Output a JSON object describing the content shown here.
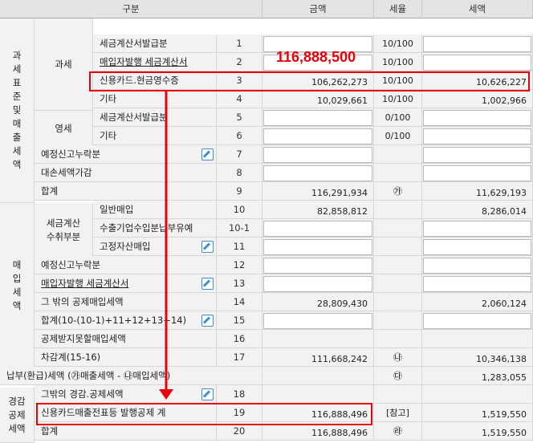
{
  "header": {
    "col_gubun": "구분",
    "col_amount": "금액",
    "col_rate": "세율",
    "col_tax": "세액"
  },
  "sections": {
    "sales": "과\n세\n표\n준\n및\n매\n출\n세\n액",
    "taxable": "과세",
    "zero_rate": "영세",
    "purchase": "매\n입\n세\n액",
    "invoice_received": "세금계산\n수취부분",
    "deduction": "경감\n공제\n세액"
  },
  "rows": [
    {
      "no": "1",
      "label": "세금계산서발급분",
      "amount": "",
      "rate": "10/100",
      "tax": ""
    },
    {
      "no": "2",
      "label": "매입자발행 세금계산서",
      "amount": "",
      "rate": "10/100",
      "tax": ""
    },
    {
      "no": "3",
      "label": "신용카드.현금영수증",
      "amount": "106,262,273",
      "rate": "10/100",
      "tax": "10,626,227"
    },
    {
      "no": "4",
      "label": "기타",
      "amount": "10,029,661",
      "rate": "10/100",
      "tax": "1,002,966"
    },
    {
      "no": "5",
      "label": "세금계산서발급분",
      "amount": "",
      "rate": "0/100",
      "tax": ""
    },
    {
      "no": "6",
      "label": "기타",
      "amount": "",
      "rate": "0/100",
      "tax": ""
    },
    {
      "no": "7",
      "label": "예정신고누락분",
      "amount": "",
      "rate": "",
      "tax": ""
    },
    {
      "no": "8",
      "label": "대손세액가감",
      "amount": "",
      "rate": "",
      "tax": ""
    },
    {
      "no": "9",
      "label": "합계",
      "amount": "116,291,934",
      "rate": "㉮",
      "tax": "11,629,193"
    },
    {
      "no": "10",
      "label": "일반매입",
      "amount": "82,858,812",
      "rate": "",
      "tax": "8,286,014"
    },
    {
      "no": "10-1",
      "label": "수출기업수입분납부유예",
      "amount": "",
      "rate": "",
      "tax": ""
    },
    {
      "no": "11",
      "label": "고정자산매입",
      "amount": "",
      "rate": "",
      "tax": ""
    },
    {
      "no": "12",
      "label": "예정신고누락분",
      "amount": "",
      "rate": "",
      "tax": ""
    },
    {
      "no": "13",
      "label": "매입자발행 세금계산서",
      "amount": "",
      "rate": "",
      "tax": ""
    },
    {
      "no": "14",
      "label": "그 밖의 공제매입세액",
      "amount": "28,809,430",
      "rate": "",
      "tax": "2,060,124"
    },
    {
      "no": "15",
      "label": "합계(10-(10-1)+11+12+13+14)",
      "amount": "111,668,242",
      "rate": "",
      "tax": "10,346,138"
    },
    {
      "no": "16",
      "label": "공제받지못할매입세액",
      "amount": "",
      "rate": "",
      "tax": ""
    },
    {
      "no": "17",
      "label": "차감계(15-16)",
      "amount": "111,668,242",
      "rate": "㉯",
      "tax": "10,346,138"
    },
    {
      "no": "",
      "label": "납부(환급)세액 (㉮매출세액 - ㉯매입세액)",
      "amount": "",
      "rate": "㉰",
      "tax": "1,283,055"
    },
    {
      "no": "18",
      "label": "그밖의 경감.공제세액",
      "amount": "",
      "rate": "",
      "tax": ""
    },
    {
      "no": "19",
      "label": "신용카드매출전표등 발행공제 계",
      "amount": "116,888,496",
      "rate": "[참고]",
      "tax": "1,519,550"
    },
    {
      "no": "20",
      "label": "합계",
      "amount": "116,888,496",
      "rate": "㉱",
      "tax": "1,519,550"
    }
  ],
  "annotation": {
    "big_amount": "116,888,500",
    "color": "#e8000b"
  },
  "edit_icon": "pencil-edit-icon"
}
